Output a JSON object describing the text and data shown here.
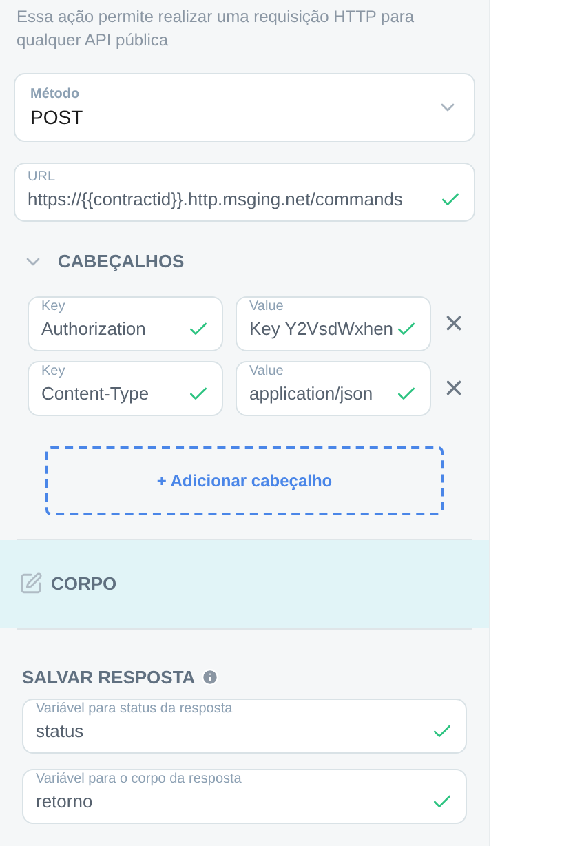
{
  "description": "Essa ação permite realizar uma requisição HTTP para qualquer API pública",
  "method": {
    "label": "Método",
    "value": "POST"
  },
  "url": {
    "label": "URL",
    "value": "https://{{contractid}}.http.msging.net/commands",
    "valid": true
  },
  "headers_section": {
    "title": "CABEÇALHOS",
    "expanded": true,
    "headers": [
      {
        "key_label": "Key",
        "key": "Authorization",
        "key_valid": true,
        "value_label": "Value",
        "value": "Key Y2VsdWxhen",
        "value_valid": true
      },
      {
        "key_label": "Key",
        "key": "Content-Type",
        "key_valid": true,
        "value_label": "Value",
        "value": "application/json",
        "value_valid": true
      }
    ],
    "add_button": "+ Adicionar cabeçalho"
  },
  "body_section": {
    "title": "CORPO"
  },
  "save_response": {
    "title": "SALVAR RESPOSTA",
    "fields": [
      {
        "label": "Variável para status da resposta",
        "value": "status",
        "valid": true
      },
      {
        "label": "Variável para o corpo da resposta",
        "value": "retorno",
        "valid": true
      }
    ]
  }
}
